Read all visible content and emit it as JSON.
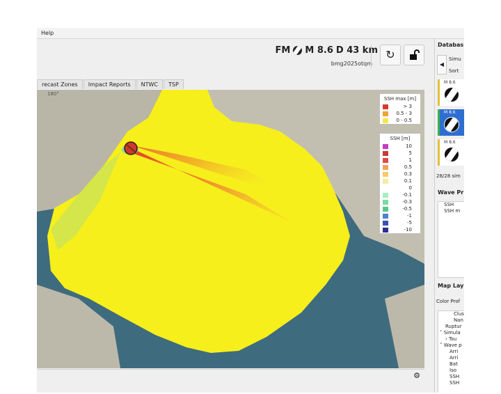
{
  "menu": {
    "help": "Help"
  },
  "header": {
    "event_prefix": "FM",
    "magnitude": "M 8.6",
    "depth": "D 43 km",
    "event_id": "bmg2025otqm",
    "refresh_icon": "refresh-icon",
    "unlock_icon": "unlock-icon"
  },
  "tabs": [
    {
      "label": "recast Zones"
    },
    {
      "label": "Impact Reports"
    },
    {
      "label": "NTWC"
    },
    {
      "label": "TSP"
    }
  ],
  "map": {
    "graticule_label": "180°",
    "legend_max": {
      "title": "SSH max [m]",
      "items": [
        {
          "label": "> 3",
          "color": "#d93a2b"
        },
        {
          "label": "0.5 - 3",
          "color": "#f2a13a"
        },
        {
          "label": "0 - 0.5",
          "color": "#f6e84a"
        }
      ]
    },
    "legend_ssh": {
      "title": "SSH [m]",
      "items": [
        {
          "label": "10",
          "color": "#c43ec4"
        },
        {
          "label": "5",
          "color": "#c93a3a"
        },
        {
          "label": "1",
          "color": "#e24a4a"
        },
        {
          "label": "0.5",
          "color": "#f2a35a"
        },
        {
          "label": "0.3",
          "color": "#f5cc6a"
        },
        {
          "label": "0.1",
          "color": "#f7ec9a"
        },
        {
          "label": "0",
          "color": "#ffffff"
        },
        {
          "label": "-0.1",
          "color": "#a8ecc2"
        },
        {
          "label": "-0.3",
          "color": "#7adca0"
        },
        {
          "label": "-0.5",
          "color": "#55c98a"
        },
        {
          "label": "-1",
          "color": "#4f7fd0"
        },
        {
          "label": "-5",
          "color": "#3a4fb8"
        },
        {
          "label": "-10",
          "color": "#2b2f8a"
        }
      ]
    }
  },
  "bottom": {
    "settings_icon": "gear-icon"
  },
  "right_panel": {
    "database_title": "Databas",
    "simu": "Simu",
    "sort": "Sort",
    "cards": [
      {
        "mag": "M 8.6"
      },
      {
        "mag": "M 8.6"
      },
      {
        "mag": "M 8.6"
      }
    ],
    "count": "28/28 sim",
    "wave_title": "Wave Pr",
    "wave_items": [
      "SSH",
      "SSH m"
    ],
    "map_layers_title": "Map Lay",
    "color_profile": "Color Prof",
    "tree": [
      "Clus",
      "Nan",
      "Ruptur",
      "˅ Simula",
      "› Tsu",
      "˅ Wave p",
      "Arri",
      "Arri",
      "Bat",
      "Iso",
      "SSH",
      "SSH"
    ]
  }
}
